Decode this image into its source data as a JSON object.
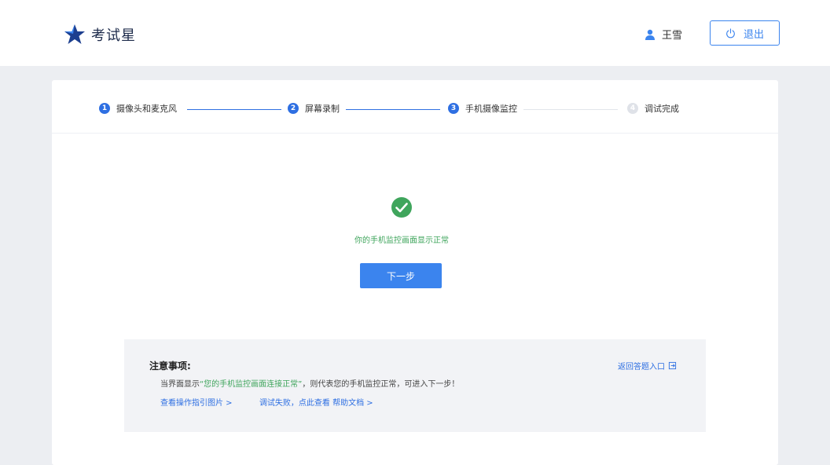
{
  "header": {
    "logo_text": "考试星",
    "user_name": "王雪",
    "logout_label": "退出"
  },
  "steps": [
    {
      "num": "1",
      "label": "摄像头和麦克风",
      "status": "done"
    },
    {
      "num": "2",
      "label": "屏幕录制",
      "status": "done"
    },
    {
      "num": "3",
      "label": "手机摄像监控",
      "status": "current"
    },
    {
      "num": "4",
      "label": "调试完成",
      "status": "pending"
    }
  ],
  "status": {
    "message": "你的手机监控画面显示正常",
    "icon": "check-circle-icon",
    "color": "#3fa55c"
  },
  "next_button": "下一步",
  "notice": {
    "title": "注意事项:",
    "line_prefix": "当界面显示",
    "line_highlight": "“您的手机监控画面连接正常”",
    "line_suffix": "，则代表您的手机监控正常，可进入下一步！",
    "link_guide": "查看操作指引图片 >",
    "fail_text": "调试失败，点此查看",
    "link_help": "帮助文档 >",
    "return_link": "返回答题入口"
  },
  "colors": {
    "accent": "#3b84ee",
    "step_active": "#2e6fe2",
    "success": "#3fa55c",
    "background": "#eceef2"
  }
}
